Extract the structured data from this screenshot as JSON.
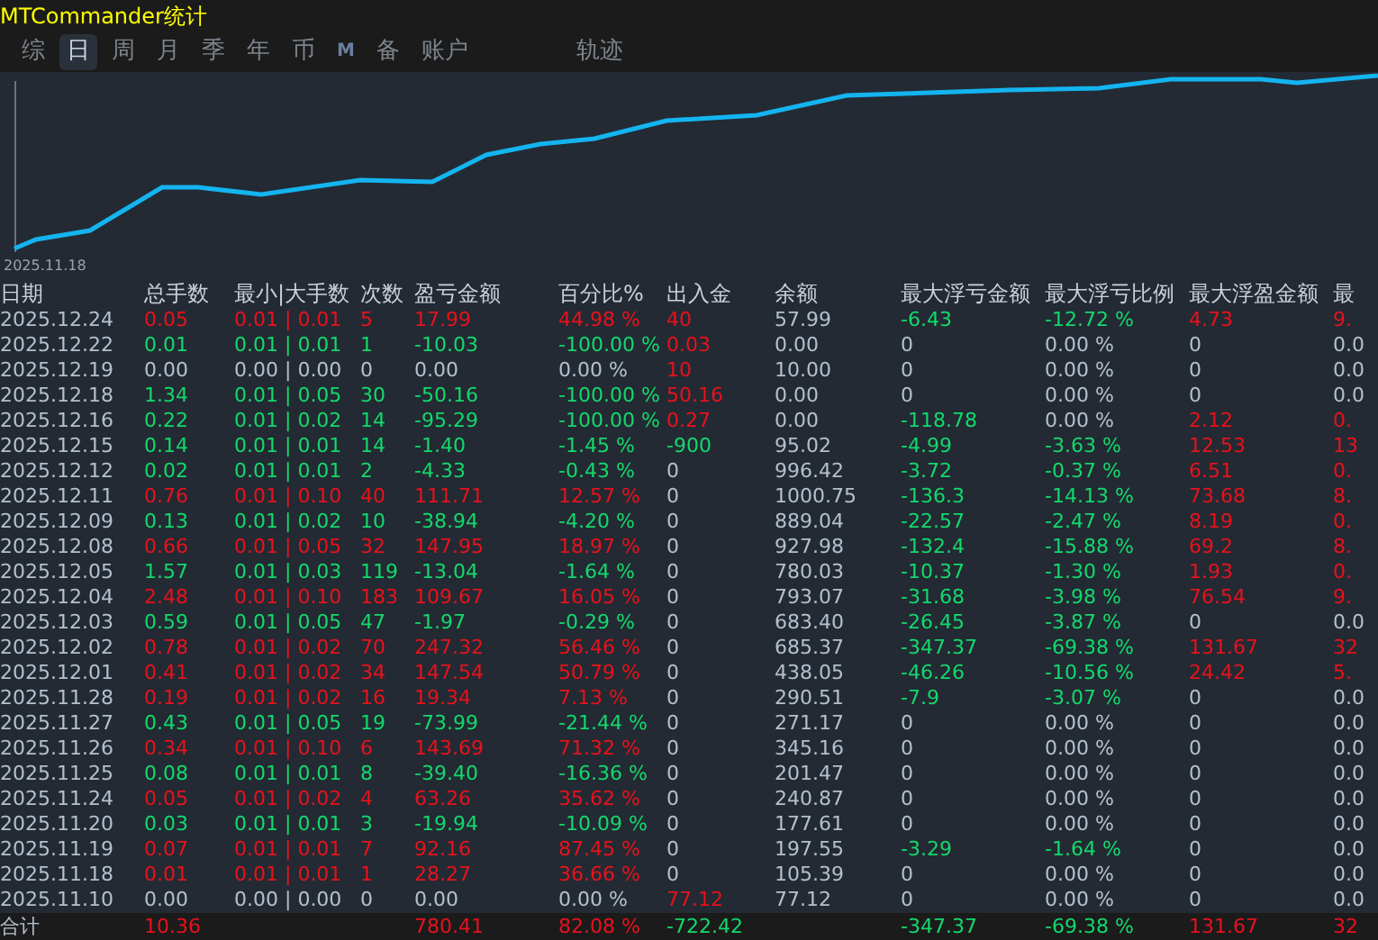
{
  "window": {
    "title": "MTCommander统计"
  },
  "tabs": [
    {
      "label": "综",
      "selected": false
    },
    {
      "label": "日",
      "selected": true
    },
    {
      "label": "周",
      "selected": false
    },
    {
      "label": "月",
      "selected": false
    },
    {
      "label": "季",
      "selected": false
    },
    {
      "label": "年",
      "selected": false
    },
    {
      "label": "币",
      "selected": false
    },
    {
      "label": "M",
      "selected": false
    },
    {
      "label": "备",
      "selected": false
    },
    {
      "label": "账户",
      "selected": false
    },
    {
      "label": "轨迹",
      "selected": false
    }
  ],
  "chart": {
    "x_label": "2025.11.18"
  },
  "table": {
    "columns": [
      "日期",
      "总手数",
      "最小|大手数",
      "次数",
      "盈亏金额",
      "百分比%",
      "出入金",
      "余额",
      "最大浮亏金额",
      "最大浮亏比例",
      "最大浮盈金额",
      "最"
    ],
    "rows": [
      [
        {
          "text": "2025.12.24",
          "color": "#b4c0cc"
        },
        {
          "text": "0.05",
          "color": "#e8121c"
        },
        {
          "text": "0.01 | 0.01",
          "color": "#e8121c"
        },
        {
          "text": "5",
          "color": "#e8121c"
        },
        {
          "text": "17.99",
          "color": "#e8121c"
        },
        {
          "text": "44.98 %",
          "color": "#e8121c"
        },
        {
          "text": "40",
          "color": "#e8121c"
        },
        {
          "text": "57.99",
          "color": "#b4c0cc"
        },
        {
          "text": "-6.43",
          "color": "#14d86c"
        },
        {
          "text": "-12.72 %",
          "color": "#14d86c"
        },
        {
          "text": "4.73",
          "color": "#e8121c"
        },
        {
          "text": "9.",
          "color": "#e8121c"
        }
      ],
      [
        {
          "text": "2025.12.22",
          "color": "#b4c0cc"
        },
        {
          "text": "0.01",
          "color": "#14d86c"
        },
        {
          "text": "0.01 | 0.01",
          "color": "#14d86c"
        },
        {
          "text": "1",
          "color": "#14d86c"
        },
        {
          "text": "-10.03",
          "color": "#14d86c"
        },
        {
          "text": "-100.00 %",
          "color": "#14d86c"
        },
        {
          "text": "0.03",
          "color": "#e8121c"
        },
        {
          "text": "0.00",
          "color": "#b4c0cc"
        },
        {
          "text": "0",
          "color": "#b4c0cc"
        },
        {
          "text": "0.00 %",
          "color": "#b4c0cc"
        },
        {
          "text": "0",
          "color": "#b4c0cc"
        },
        {
          "text": "0.0",
          "color": "#b4c0cc"
        }
      ],
      [
        {
          "text": "2025.12.19",
          "color": "#b4c0cc"
        },
        {
          "text": "0.00",
          "color": "#b4c0cc"
        },
        {
          "text": "0.00 | 0.00",
          "color": "#b4c0cc"
        },
        {
          "text": "0",
          "color": "#b4c0cc"
        },
        {
          "text": "0.00",
          "color": "#b4c0cc"
        },
        {
          "text": "0.00 %",
          "color": "#b4c0cc"
        },
        {
          "text": "10",
          "color": "#e8121c"
        },
        {
          "text": "10.00",
          "color": "#b4c0cc"
        },
        {
          "text": "0",
          "color": "#b4c0cc"
        },
        {
          "text": "0.00 %",
          "color": "#b4c0cc"
        },
        {
          "text": "0",
          "color": "#b4c0cc"
        },
        {
          "text": "0.0",
          "color": "#b4c0cc"
        }
      ],
      [
        {
          "text": "2025.12.18",
          "color": "#b4c0cc"
        },
        {
          "text": "1.34",
          "color": "#14d86c"
        },
        {
          "text": "0.01 | 0.05",
          "color": "#14d86c"
        },
        {
          "text": "30",
          "color": "#14d86c"
        },
        {
          "text": "-50.16",
          "color": "#14d86c"
        },
        {
          "text": "-100.00 %",
          "color": "#14d86c"
        },
        {
          "text": "50.16",
          "color": "#e8121c"
        },
        {
          "text": "0.00",
          "color": "#b4c0cc"
        },
        {
          "text": "0",
          "color": "#b4c0cc"
        },
        {
          "text": "0.00 %",
          "color": "#b4c0cc"
        },
        {
          "text": "0",
          "color": "#b4c0cc"
        },
        {
          "text": "0.0",
          "color": "#b4c0cc"
        }
      ],
      [
        {
          "text": "2025.12.16",
          "color": "#b4c0cc"
        },
        {
          "text": "0.22",
          "color": "#14d86c"
        },
        {
          "text": "0.01 | 0.02",
          "color": "#14d86c"
        },
        {
          "text": "14",
          "color": "#14d86c"
        },
        {
          "text": "-95.29",
          "color": "#14d86c"
        },
        {
          "text": "-100.00 %",
          "color": "#14d86c"
        },
        {
          "text": "0.27",
          "color": "#e8121c"
        },
        {
          "text": "0.00",
          "color": "#b4c0cc"
        },
        {
          "text": "-118.78",
          "color": "#14d86c"
        },
        {
          "text": "0.00 %",
          "color": "#b4c0cc"
        },
        {
          "text": "2.12",
          "color": "#e8121c"
        },
        {
          "text": "0.",
          "color": "#e8121c"
        }
      ],
      [
        {
          "text": "2025.12.15",
          "color": "#b4c0cc"
        },
        {
          "text": "0.14",
          "color": "#14d86c"
        },
        {
          "text": "0.01 | 0.01",
          "color": "#14d86c"
        },
        {
          "text": "14",
          "color": "#14d86c"
        },
        {
          "text": "-1.40",
          "color": "#14d86c"
        },
        {
          "text": "-1.45 %",
          "color": "#14d86c"
        },
        {
          "text": "-900",
          "color": "#14d86c"
        },
        {
          "text": "95.02",
          "color": "#b4c0cc"
        },
        {
          "text": "-4.99",
          "color": "#14d86c"
        },
        {
          "text": "-3.63 %",
          "color": "#14d86c"
        },
        {
          "text": "12.53",
          "color": "#e8121c"
        },
        {
          "text": "13",
          "color": "#e8121c"
        }
      ],
      [
        {
          "text": "2025.12.12",
          "color": "#b4c0cc"
        },
        {
          "text": "0.02",
          "color": "#14d86c"
        },
        {
          "text": "0.01 | 0.01",
          "color": "#14d86c"
        },
        {
          "text": "2",
          "color": "#14d86c"
        },
        {
          "text": "-4.33",
          "color": "#14d86c"
        },
        {
          "text": "-0.43 %",
          "color": "#14d86c"
        },
        {
          "text": "0",
          "color": "#b4c0cc"
        },
        {
          "text": "996.42",
          "color": "#b4c0cc"
        },
        {
          "text": "-3.72",
          "color": "#14d86c"
        },
        {
          "text": "-0.37 %",
          "color": "#14d86c"
        },
        {
          "text": "6.51",
          "color": "#e8121c"
        },
        {
          "text": "0.",
          "color": "#e8121c"
        }
      ],
      [
        {
          "text": "2025.12.11",
          "color": "#b4c0cc"
        },
        {
          "text": "0.76",
          "color": "#e8121c"
        },
        {
          "text": "0.01 | 0.10",
          "color": "#e8121c"
        },
        {
          "text": "40",
          "color": "#e8121c"
        },
        {
          "text": "111.71",
          "color": "#e8121c"
        },
        {
          "text": "12.57 %",
          "color": "#e8121c"
        },
        {
          "text": "0",
          "color": "#b4c0cc"
        },
        {
          "text": "1000.75",
          "color": "#b4c0cc"
        },
        {
          "text": "-136.3",
          "color": "#14d86c"
        },
        {
          "text": "-14.13 %",
          "color": "#14d86c"
        },
        {
          "text": "73.68",
          "color": "#e8121c"
        },
        {
          "text": "8.",
          "color": "#e8121c"
        }
      ],
      [
        {
          "text": "2025.12.09",
          "color": "#b4c0cc"
        },
        {
          "text": "0.13",
          "color": "#14d86c"
        },
        {
          "text": "0.01 | 0.02",
          "color": "#14d86c"
        },
        {
          "text": "10",
          "color": "#14d86c"
        },
        {
          "text": "-38.94",
          "color": "#14d86c"
        },
        {
          "text": "-4.20 %",
          "color": "#14d86c"
        },
        {
          "text": "0",
          "color": "#b4c0cc"
        },
        {
          "text": "889.04",
          "color": "#b4c0cc"
        },
        {
          "text": "-22.57",
          "color": "#14d86c"
        },
        {
          "text": "-2.47 %",
          "color": "#14d86c"
        },
        {
          "text": "8.19",
          "color": "#e8121c"
        },
        {
          "text": "0.",
          "color": "#e8121c"
        }
      ],
      [
        {
          "text": "2025.12.08",
          "color": "#b4c0cc"
        },
        {
          "text": "0.66",
          "color": "#e8121c"
        },
        {
          "text": "0.01 | 0.05",
          "color": "#e8121c"
        },
        {
          "text": "32",
          "color": "#e8121c"
        },
        {
          "text": "147.95",
          "color": "#e8121c"
        },
        {
          "text": "18.97 %",
          "color": "#e8121c"
        },
        {
          "text": "0",
          "color": "#b4c0cc"
        },
        {
          "text": "927.98",
          "color": "#b4c0cc"
        },
        {
          "text": "-132.4",
          "color": "#14d86c"
        },
        {
          "text": "-15.88 %",
          "color": "#14d86c"
        },
        {
          "text": "69.2",
          "color": "#e8121c"
        },
        {
          "text": "8.",
          "color": "#e8121c"
        }
      ],
      [
        {
          "text": "2025.12.05",
          "color": "#b4c0cc"
        },
        {
          "text": "1.57",
          "color": "#14d86c"
        },
        {
          "text": "0.01 | 0.03",
          "color": "#14d86c"
        },
        {
          "text": "119",
          "color": "#14d86c"
        },
        {
          "text": "-13.04",
          "color": "#14d86c"
        },
        {
          "text": "-1.64 %",
          "color": "#14d86c"
        },
        {
          "text": "0",
          "color": "#b4c0cc"
        },
        {
          "text": "780.03",
          "color": "#b4c0cc"
        },
        {
          "text": "-10.37",
          "color": "#14d86c"
        },
        {
          "text": "-1.30 %",
          "color": "#14d86c"
        },
        {
          "text": "1.93",
          "color": "#e8121c"
        },
        {
          "text": "0.",
          "color": "#e8121c"
        }
      ],
      [
        {
          "text": "2025.12.04",
          "color": "#b4c0cc"
        },
        {
          "text": "2.48",
          "color": "#e8121c"
        },
        {
          "text": "0.01 | 0.10",
          "color": "#e8121c"
        },
        {
          "text": "183",
          "color": "#e8121c"
        },
        {
          "text": "109.67",
          "color": "#e8121c"
        },
        {
          "text": "16.05 %",
          "color": "#e8121c"
        },
        {
          "text": "0",
          "color": "#b4c0cc"
        },
        {
          "text": "793.07",
          "color": "#b4c0cc"
        },
        {
          "text": "-31.68",
          "color": "#14d86c"
        },
        {
          "text": "-3.98 %",
          "color": "#14d86c"
        },
        {
          "text": "76.54",
          "color": "#e8121c"
        },
        {
          "text": "9.",
          "color": "#e8121c"
        }
      ],
      [
        {
          "text": "2025.12.03",
          "color": "#b4c0cc"
        },
        {
          "text": "0.59",
          "color": "#14d86c"
        },
        {
          "text": "0.01 | 0.05",
          "color": "#14d86c"
        },
        {
          "text": "47",
          "color": "#14d86c"
        },
        {
          "text": "-1.97",
          "color": "#14d86c"
        },
        {
          "text": "-0.29 %",
          "color": "#14d86c"
        },
        {
          "text": "0",
          "color": "#b4c0cc"
        },
        {
          "text": "683.40",
          "color": "#b4c0cc"
        },
        {
          "text": "-26.45",
          "color": "#14d86c"
        },
        {
          "text": "-3.87 %",
          "color": "#14d86c"
        },
        {
          "text": "0",
          "color": "#b4c0cc"
        },
        {
          "text": "0.0",
          "color": "#b4c0cc"
        }
      ],
      [
        {
          "text": "2025.12.02",
          "color": "#b4c0cc"
        },
        {
          "text": "0.78",
          "color": "#e8121c"
        },
        {
          "text": "0.01 | 0.02",
          "color": "#e8121c"
        },
        {
          "text": "70",
          "color": "#e8121c"
        },
        {
          "text": "247.32",
          "color": "#e8121c"
        },
        {
          "text": "56.46 %",
          "color": "#e8121c"
        },
        {
          "text": "0",
          "color": "#b4c0cc"
        },
        {
          "text": "685.37",
          "color": "#b4c0cc"
        },
        {
          "text": "-347.37",
          "color": "#14d86c"
        },
        {
          "text": "-69.38 %",
          "color": "#14d86c"
        },
        {
          "text": "131.67",
          "color": "#e8121c"
        },
        {
          "text": "32",
          "color": "#e8121c"
        }
      ],
      [
        {
          "text": "2025.12.01",
          "color": "#b4c0cc"
        },
        {
          "text": "0.41",
          "color": "#e8121c"
        },
        {
          "text": "0.01 | 0.02",
          "color": "#e8121c"
        },
        {
          "text": "34",
          "color": "#e8121c"
        },
        {
          "text": "147.54",
          "color": "#e8121c"
        },
        {
          "text": "50.79 %",
          "color": "#e8121c"
        },
        {
          "text": "0",
          "color": "#b4c0cc"
        },
        {
          "text": "438.05",
          "color": "#b4c0cc"
        },
        {
          "text": "-46.26",
          "color": "#14d86c"
        },
        {
          "text": "-10.56 %",
          "color": "#14d86c"
        },
        {
          "text": "24.42",
          "color": "#e8121c"
        },
        {
          "text": "5.",
          "color": "#e8121c"
        }
      ],
      [
        {
          "text": "2025.11.28",
          "color": "#b4c0cc"
        },
        {
          "text": "0.19",
          "color": "#e8121c"
        },
        {
          "text": "0.01 | 0.02",
          "color": "#e8121c"
        },
        {
          "text": "16",
          "color": "#e8121c"
        },
        {
          "text": "19.34",
          "color": "#e8121c"
        },
        {
          "text": "7.13 %",
          "color": "#e8121c"
        },
        {
          "text": "0",
          "color": "#b4c0cc"
        },
        {
          "text": "290.51",
          "color": "#b4c0cc"
        },
        {
          "text": "-7.9",
          "color": "#14d86c"
        },
        {
          "text": "-3.07 %",
          "color": "#14d86c"
        },
        {
          "text": "0",
          "color": "#b4c0cc"
        },
        {
          "text": "0.0",
          "color": "#b4c0cc"
        }
      ],
      [
        {
          "text": "2025.11.27",
          "color": "#b4c0cc"
        },
        {
          "text": "0.43",
          "color": "#14d86c"
        },
        {
          "text": "0.01 | 0.05",
          "color": "#14d86c"
        },
        {
          "text": "19",
          "color": "#14d86c"
        },
        {
          "text": "-73.99",
          "color": "#14d86c"
        },
        {
          "text": "-21.44 %",
          "color": "#14d86c"
        },
        {
          "text": "0",
          "color": "#b4c0cc"
        },
        {
          "text": "271.17",
          "color": "#b4c0cc"
        },
        {
          "text": "0",
          "color": "#b4c0cc"
        },
        {
          "text": "0.00 %",
          "color": "#b4c0cc"
        },
        {
          "text": "0",
          "color": "#b4c0cc"
        },
        {
          "text": "0.0",
          "color": "#b4c0cc"
        }
      ],
      [
        {
          "text": "2025.11.26",
          "color": "#b4c0cc"
        },
        {
          "text": "0.34",
          "color": "#e8121c"
        },
        {
          "text": "0.01 | 0.10",
          "color": "#e8121c"
        },
        {
          "text": "6",
          "color": "#e8121c"
        },
        {
          "text": "143.69",
          "color": "#e8121c"
        },
        {
          "text": "71.32 %",
          "color": "#e8121c"
        },
        {
          "text": "0",
          "color": "#b4c0cc"
        },
        {
          "text": "345.16",
          "color": "#b4c0cc"
        },
        {
          "text": "0",
          "color": "#b4c0cc"
        },
        {
          "text": "0.00 %",
          "color": "#b4c0cc"
        },
        {
          "text": "0",
          "color": "#b4c0cc"
        },
        {
          "text": "0.0",
          "color": "#b4c0cc"
        }
      ],
      [
        {
          "text": "2025.11.25",
          "color": "#b4c0cc"
        },
        {
          "text": "0.08",
          "color": "#14d86c"
        },
        {
          "text": "0.01 | 0.01",
          "color": "#14d86c"
        },
        {
          "text": "8",
          "color": "#14d86c"
        },
        {
          "text": "-39.40",
          "color": "#14d86c"
        },
        {
          "text": "-16.36 %",
          "color": "#14d86c"
        },
        {
          "text": "0",
          "color": "#b4c0cc"
        },
        {
          "text": "201.47",
          "color": "#b4c0cc"
        },
        {
          "text": "0",
          "color": "#b4c0cc"
        },
        {
          "text": "0.00 %",
          "color": "#b4c0cc"
        },
        {
          "text": "0",
          "color": "#b4c0cc"
        },
        {
          "text": "0.0",
          "color": "#b4c0cc"
        }
      ],
      [
        {
          "text": "2025.11.24",
          "color": "#b4c0cc"
        },
        {
          "text": "0.05",
          "color": "#e8121c"
        },
        {
          "text": "0.01 | 0.02",
          "color": "#e8121c"
        },
        {
          "text": "4",
          "color": "#e8121c"
        },
        {
          "text": "63.26",
          "color": "#e8121c"
        },
        {
          "text": "35.62 %",
          "color": "#e8121c"
        },
        {
          "text": "0",
          "color": "#b4c0cc"
        },
        {
          "text": "240.87",
          "color": "#b4c0cc"
        },
        {
          "text": "0",
          "color": "#b4c0cc"
        },
        {
          "text": "0.00 %",
          "color": "#b4c0cc"
        },
        {
          "text": "0",
          "color": "#b4c0cc"
        },
        {
          "text": "0.0",
          "color": "#b4c0cc"
        }
      ],
      [
        {
          "text": "2025.11.20",
          "color": "#b4c0cc"
        },
        {
          "text": "0.03",
          "color": "#14d86c"
        },
        {
          "text": "0.01 | 0.01",
          "color": "#14d86c"
        },
        {
          "text": "3",
          "color": "#14d86c"
        },
        {
          "text": "-19.94",
          "color": "#14d86c"
        },
        {
          "text": "-10.09 %",
          "color": "#14d86c"
        },
        {
          "text": "0",
          "color": "#b4c0cc"
        },
        {
          "text": "177.61",
          "color": "#b4c0cc"
        },
        {
          "text": "0",
          "color": "#b4c0cc"
        },
        {
          "text": "0.00 %",
          "color": "#b4c0cc"
        },
        {
          "text": "0",
          "color": "#b4c0cc"
        },
        {
          "text": "0.0",
          "color": "#b4c0cc"
        }
      ],
      [
        {
          "text": "2025.11.19",
          "color": "#b4c0cc"
        },
        {
          "text": "0.07",
          "color": "#e8121c"
        },
        {
          "text": "0.01 | 0.01",
          "color": "#e8121c"
        },
        {
          "text": "7",
          "color": "#e8121c"
        },
        {
          "text": "92.16",
          "color": "#e8121c"
        },
        {
          "text": "87.45 %",
          "color": "#e8121c"
        },
        {
          "text": "0",
          "color": "#b4c0cc"
        },
        {
          "text": "197.55",
          "color": "#b4c0cc"
        },
        {
          "text": "-3.29",
          "color": "#14d86c"
        },
        {
          "text": "-1.64 %",
          "color": "#14d86c"
        },
        {
          "text": "0",
          "color": "#b4c0cc"
        },
        {
          "text": "0.0",
          "color": "#b4c0cc"
        }
      ],
      [
        {
          "text": "2025.11.18",
          "color": "#b4c0cc"
        },
        {
          "text": "0.01",
          "color": "#e8121c"
        },
        {
          "text": "0.01 | 0.01",
          "color": "#e8121c"
        },
        {
          "text": "1",
          "color": "#e8121c"
        },
        {
          "text": "28.27",
          "color": "#e8121c"
        },
        {
          "text": "36.66 %",
          "color": "#e8121c"
        },
        {
          "text": "0",
          "color": "#b4c0cc"
        },
        {
          "text": "105.39",
          "color": "#b4c0cc"
        },
        {
          "text": "0",
          "color": "#b4c0cc"
        },
        {
          "text": "0.00 %",
          "color": "#b4c0cc"
        },
        {
          "text": "0",
          "color": "#b4c0cc"
        },
        {
          "text": "0.0",
          "color": "#b4c0cc"
        }
      ],
      [
        {
          "text": "2025.11.10",
          "color": "#b4c0cc"
        },
        {
          "text": "0.00",
          "color": "#b4c0cc"
        },
        {
          "text": "0.00 | 0.00",
          "color": "#b4c0cc"
        },
        {
          "text": "0",
          "color": "#b4c0cc"
        },
        {
          "text": "0.00",
          "color": "#b4c0cc"
        },
        {
          "text": "0.00 %",
          "color": "#b4c0cc"
        },
        {
          "text": "77.12",
          "color": "#e8121c"
        },
        {
          "text": "77.12",
          "color": "#b4c0cc"
        },
        {
          "text": "0",
          "color": "#b4c0cc"
        },
        {
          "text": "0.00 %",
          "color": "#b4c0cc"
        },
        {
          "text": "0",
          "color": "#b4c0cc"
        },
        {
          "text": "0.0",
          "color": "#b4c0cc"
        }
      ]
    ],
    "total": {
      "label": {
        "text": "合计",
        "color": "#b4c0cc"
      },
      "total_lots": {
        "text": "10.36",
        "color": "#e8121c"
      },
      "profit": {
        "text": "780.41",
        "color": "#e8121c"
      },
      "percent": {
        "text": "82.08 %",
        "color": "#e8121c"
      },
      "deposit_withdrawal": {
        "text": "-722.42",
        "color": "#14d86c"
      },
      "max_floating_loss": {
        "text": "-347.37",
        "color": "#14d86c"
      },
      "max_floating_loss_ratio": {
        "text": "-69.38 %",
        "color": "#14d86c"
      },
      "max_floating_profit": {
        "text": "131.67",
        "color": "#e8121c"
      },
      "column_12": {
        "text": "32",
        "color": "#e8121c"
      }
    }
  }
}
